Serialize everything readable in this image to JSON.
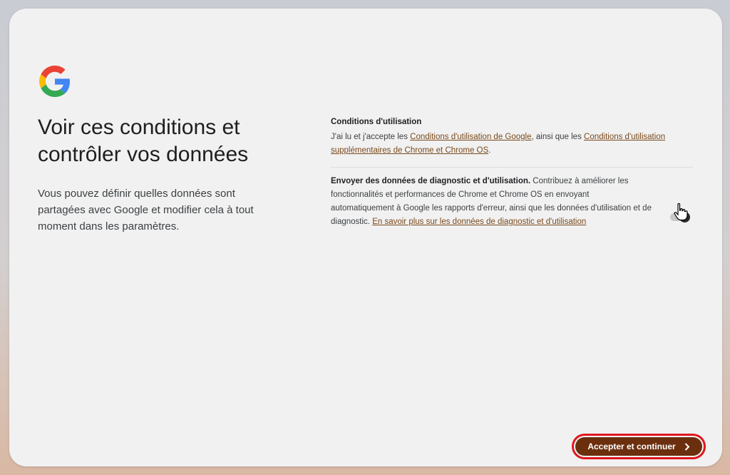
{
  "header": {
    "title": "Voir ces conditions et contrôler vos données",
    "description": "Vous pouvez définir quelles données sont partagées avec Google et modifier cela à tout moment dans les paramètres."
  },
  "terms": {
    "heading": "Conditions d'utilisation",
    "text_before": "J'ai lu et j'accepte les ",
    "link1": "Conditions d'utilisation de Google",
    "text_middle": ", ainsi que les ",
    "link2": "Conditions d'utilisation supplémentaires de Chrome et Chrome OS",
    "text_after": "."
  },
  "diagnostics": {
    "bold": "Envoyer des données de diagnostic et d'utilisation.",
    "text": " Contribuez à améliorer les fonctionnalités et performances de Chrome et Chrome OS en envoyant automatiquement à Google les rapports d'erreur, ainsi que les données d'utilisation et de diagnostic. ",
    "link": "En savoir plus sur les données de diagnostic et d'utilisation",
    "toggle_on": true
  },
  "actions": {
    "accept_label": "Accepter et continuer",
    "accept_icon": "chevron-right-icon"
  },
  "colors": {
    "accept_button": "#6b2f0e",
    "highlight_border": "#e0161e",
    "link": "#7a4a1c"
  }
}
